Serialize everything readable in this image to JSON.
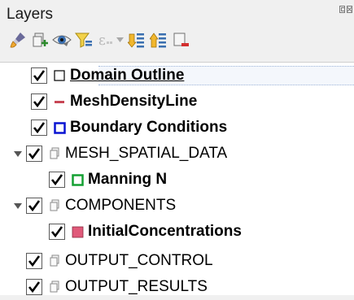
{
  "panel": {
    "title": "Layers"
  },
  "toolbar": {
    "buttons": [
      {
        "icon": "style-manager-icon"
      },
      {
        "icon": "add-group-icon"
      },
      {
        "icon": "manage-visibility-icon"
      },
      {
        "icon": "filter-legend-icon"
      },
      {
        "icon": "filter-expression-icon"
      },
      {
        "icon": "expand-all-icon"
      },
      {
        "icon": "collapse-all-icon"
      },
      {
        "icon": "remove-layer-icon"
      }
    ]
  },
  "layers": [
    {
      "label": "Domain Outline",
      "checked": true,
      "type": "layer",
      "symbol": "polygon-outline",
      "color": "#000000",
      "bold": true,
      "selected": true
    },
    {
      "label": "MeshDensityLine",
      "checked": true,
      "type": "layer",
      "symbol": "line",
      "color": "#c84655",
      "bold": true
    },
    {
      "label": "Boundary Conditions",
      "checked": true,
      "type": "layer",
      "symbol": "polygon-outline",
      "color": "#0a14d2",
      "bold": true
    },
    {
      "label": "MESH_SPATIAL_DATA",
      "checked": true,
      "type": "group",
      "expanded": true
    },
    {
      "label": "Manning N",
      "checked": true,
      "type": "layer",
      "symbol": "polygon-outline",
      "color": "#14a032",
      "bold": true
    },
    {
      "label": "COMPONENTS",
      "checked": true,
      "type": "group",
      "expanded": true
    },
    {
      "label": "InitialConcentrations",
      "checked": true,
      "type": "layer",
      "symbol": "polygon-fill",
      "color": "#e05a7a",
      "bold": true
    },
    {
      "label": "OUTPUT_CONTROL",
      "checked": true,
      "type": "group",
      "expanded": false
    },
    {
      "label": "OUTPUT_RESULTS",
      "checked": true,
      "type": "group",
      "expanded": false
    }
  ]
}
